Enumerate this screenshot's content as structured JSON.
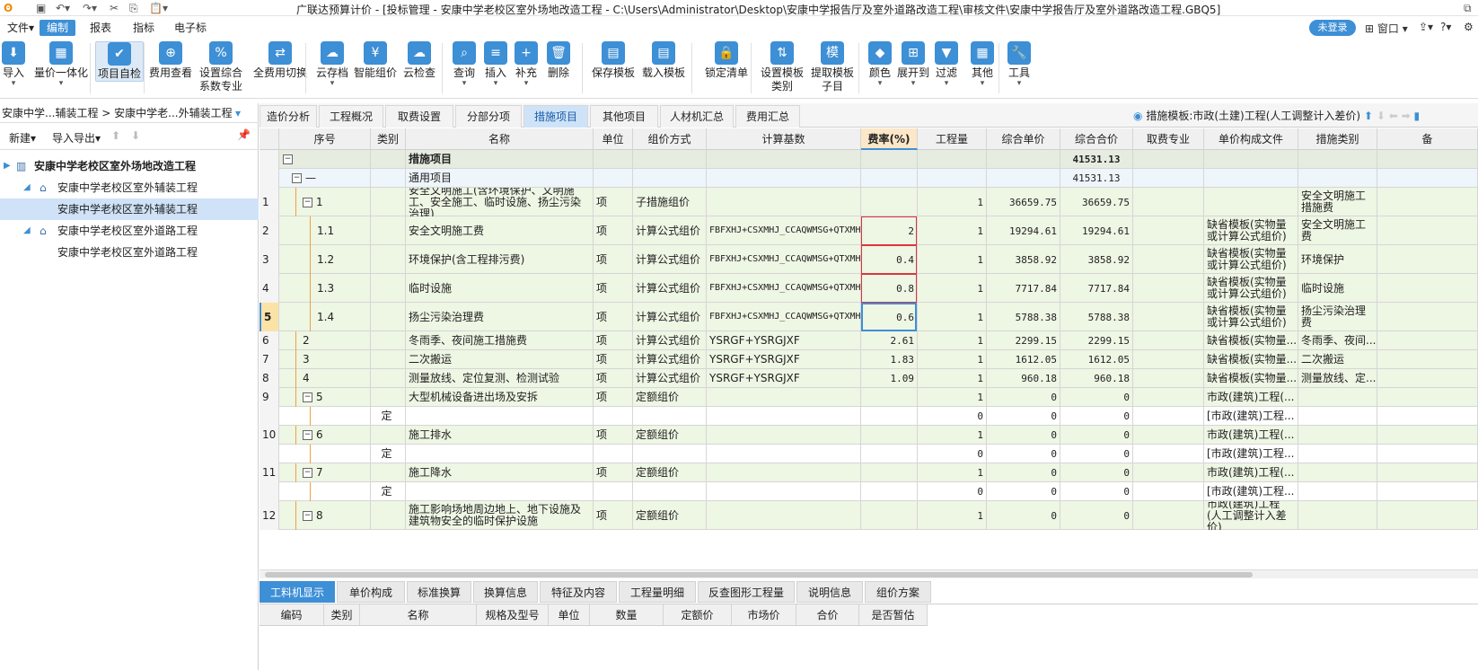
{
  "title": "广联达预算计价 - [投标管理 - 安康中学老校区室外场地改造工程 - C:\\Users\\Administrator\\Desktop\\安康中学报告厅及室外道路改造工程\\审核文件\\安康中学报告厅及室外道路改造工程.GBQ5]",
  "menu": [
    "文件▾",
    "编制",
    "报表",
    "指标",
    "电子标"
  ],
  "login": "未登录",
  "window_menu": "窗口 ▾",
  "ribbon": [
    {
      "label": "导入",
      "icon": "import-icon",
      "glyph": "⬇",
      "dd": true
    },
    {
      "label": "量价一体化",
      "icon": "integration-icon",
      "glyph": "▦",
      "dd": true
    },
    {
      "label": "项目自检",
      "icon": "self-check-icon",
      "glyph": "✔",
      "sel": true
    },
    {
      "label": "费用查看",
      "icon": "cost-view-icon",
      "glyph": "⊕"
    },
    {
      "label": "设置综合\n系数专业",
      "icon": "coefficient-icon",
      "glyph": "%"
    },
    {
      "label": "全费用切换",
      "icon": "full-cost-icon",
      "glyph": "⇄"
    },
    {
      "label": "云存档",
      "icon": "cloud-save-icon",
      "glyph": "☁",
      "dd": true
    },
    {
      "label": "智能组价",
      "icon": "smart-price-icon",
      "glyph": "¥"
    },
    {
      "label": "云检查",
      "icon": "cloud-check-icon",
      "glyph": "☁"
    },
    {
      "label": "查询",
      "icon": "query-icon",
      "glyph": "⌕",
      "dd": true
    },
    {
      "label": "插入",
      "icon": "insert-icon",
      "glyph": "≡",
      "dd": true
    },
    {
      "label": "补充",
      "icon": "supplement-icon",
      "glyph": "+",
      "dd": true
    },
    {
      "label": "删除",
      "icon": "delete-icon",
      "glyph": "🗑"
    },
    {
      "label": "保存模板",
      "icon": "save-template-icon",
      "glyph": "▤"
    },
    {
      "label": "载入模板",
      "icon": "load-template-icon",
      "glyph": "▤"
    },
    {
      "label": "锁定清单",
      "icon": "lock-icon",
      "glyph": "🔒"
    },
    {
      "label": "设置模板\n类别",
      "icon": "template-category-icon",
      "glyph": "⇅"
    },
    {
      "label": "提取模板\n子目",
      "icon": "extract-template-icon",
      "glyph": "模"
    },
    {
      "label": "颜色",
      "icon": "color-icon",
      "glyph": "◆",
      "dd": true
    },
    {
      "label": "展开到",
      "icon": "expand-icon",
      "glyph": "⊞",
      "dd": true
    },
    {
      "label": "过滤",
      "icon": "filter-icon",
      "glyph": "▼",
      "dd": true
    },
    {
      "label": "其他",
      "icon": "other-icon",
      "glyph": "▦",
      "dd": true
    },
    {
      "label": "工具",
      "icon": "tools-icon",
      "glyph": "🔧",
      "dd": true
    }
  ],
  "left": {
    "breadcrumb": "安康中学...辅装工程 > 安康中学老...外辅装工程",
    "new_btn": "新建▾",
    "import_export": "导入导出▾",
    "tree": [
      {
        "label": "安康中学老校区室外场地改造工程",
        "level": 0,
        "bold": true
      },
      {
        "label": "安康中学老校区室外辅装工程",
        "level": 1
      },
      {
        "label": "安康中学老校区室外辅装工程",
        "level": 2,
        "sel": true
      },
      {
        "label": "安康中学老校区室外道路工程",
        "level": 1
      },
      {
        "label": "安康中学老校区室外道路工程",
        "level": 2
      }
    ]
  },
  "tabs": [
    "造价分析",
    "工程概况",
    "取费设置",
    "分部分项",
    "措施项目",
    "其他项目",
    "人材机汇总",
    "费用汇总"
  ],
  "active_tab": 4,
  "template_label": "措施模板:市政(土建)工程(人工调整计入差价)",
  "columns": [
    "",
    "序号",
    "类别",
    "名称",
    "单位",
    "组价方式",
    "计算基数",
    "费率(%)",
    "工程量",
    "综合单价",
    "综合合价",
    "取费专业",
    "单价构成文件",
    "措施类别",
    "备"
  ],
  "rows": [
    {
      "n": "",
      "seq": "",
      "type": "",
      "name": "措施项目",
      "unit": "",
      "method": "",
      "base": "",
      "rate": "",
      "qty": "",
      "price": "",
      "total": "41531.13",
      "spec": "",
      "file": "",
      "cat": "",
      "kind": "header",
      "tog": "−",
      "lvl": 0
    },
    {
      "n": "",
      "seq": "—",
      "type": "",
      "name": "通用项目",
      "unit": "",
      "method": "",
      "base": "",
      "rate": "",
      "qty": "",
      "price": "",
      "total": "41531.13",
      "spec": "",
      "file": "",
      "cat": "",
      "kind": "group",
      "tog": "−",
      "lvl": 1
    },
    {
      "n": "1",
      "seq": "1",
      "type": "",
      "name": "安全文明施工(含环境保护、文明施工、安全施工、临时设施、扬尘污染治理)",
      "unit": "项",
      "method": "子措施组价",
      "base": "",
      "rate": "",
      "qty": "1",
      "price": "36659.75",
      "total": "36659.75",
      "spec": "",
      "file": "",
      "cat": "安全文明施工措施费",
      "tog": "−",
      "lvl": 2,
      "h": 32
    },
    {
      "n": "2",
      "seq": "1.1",
      "type": "",
      "name": "安全文明施工费",
      "unit": "项",
      "method": "计算公式组价",
      "base": "FBFXHJ+CSXMHJ_CCAQWMSG+QTXMHJ+FBFXRGCJ+CSXMRGCJ+QTXMRGCJ",
      "rate": "2",
      "qty": "1",
      "price": "19294.61",
      "total": "19294.61",
      "spec": "",
      "file": "缺省模板(实物量或计算公式组价)",
      "cat": "安全文明施工费",
      "lvl": 3,
      "h": 32
    },
    {
      "n": "3",
      "seq": "1.2",
      "type": "",
      "name": "环境保护(含工程排污费)",
      "unit": "项",
      "method": "计算公式组价",
      "base": "FBFXHJ+CSXMHJ_CCAQWMSG+QTXMHJ+FBFXRGCJ+CSXMRGCJ+QTXMRGCJ",
      "rate": "0.4",
      "qty": "1",
      "price": "3858.92",
      "total": "3858.92",
      "spec": "",
      "file": "缺省模板(实物量或计算公式组价)",
      "cat": "环境保护",
      "lvl": 3,
      "h": 32
    },
    {
      "n": "4",
      "seq": "1.3",
      "type": "",
      "name": "临时设施",
      "unit": "项",
      "method": "计算公式组价",
      "base": "FBFXHJ+CSXMHJ_CCAQWMSG+QTXMHJ+FBFXRGCJ+CSXMRGCJ+QTXMRGCJ",
      "rate": "0.8",
      "qty": "1",
      "price": "7717.84",
      "total": "7717.84",
      "spec": "",
      "file": "缺省模板(实物量或计算公式组价)",
      "cat": "临时设施",
      "lvl": 3,
      "h": 32
    },
    {
      "n": "5",
      "seq": "1.4",
      "type": "",
      "name": "扬尘污染治理费",
      "unit": "项",
      "method": "计算公式组价",
      "base": "FBFXHJ+CSXMHJ_CCAQWMSG+QTXMHJ+FBFXRGCJ+CSXMRGCJ+QTXMRGCJ",
      "rate": "0.6",
      "qty": "1",
      "price": "5788.38",
      "total": "5788.38",
      "spec": "",
      "file": "缺省模板(实物量或计算公式组价)",
      "cat": "扬尘污染治理费",
      "lvl": 3,
      "h": 32,
      "cur": true
    },
    {
      "n": "6",
      "seq": "2",
      "type": "",
      "name": "冬雨季、夜间施工措施费",
      "unit": "项",
      "method": "计算公式组价",
      "base": "YSRGF+YSRGJXF",
      "rate": "2.61",
      "qty": "1",
      "price": "2299.15",
      "total": "2299.15",
      "spec": "",
      "file": "缺省模板(实物量...",
      "cat": "冬雨季、夜间...",
      "lvl": 2
    },
    {
      "n": "7",
      "seq": "3",
      "type": "",
      "name": "二次搬运",
      "unit": "项",
      "method": "计算公式组价",
      "base": "YSRGF+YSRGJXF",
      "rate": "1.83",
      "qty": "1",
      "price": "1612.05",
      "total": "1612.05",
      "spec": "",
      "file": "缺省模板(实物量...",
      "cat": "二次搬运",
      "lvl": 2
    },
    {
      "n": "8",
      "seq": "4",
      "type": "",
      "name": "测量放线、定位复测、检测试验",
      "unit": "项",
      "method": "计算公式组价",
      "base": "YSRGF+YSRGJXF",
      "rate": "1.09",
      "qty": "1",
      "price": "960.18",
      "total": "960.18",
      "spec": "",
      "file": "缺省模板(实物量...",
      "cat": "测量放线、定...",
      "lvl": 2
    },
    {
      "n": "9",
      "seq": "5",
      "type": "",
      "name": "大型机械设备进出场及安拆",
      "unit": "项",
      "method": "定额组价",
      "base": "",
      "rate": "",
      "qty": "1",
      "price": "0",
      "total": "0",
      "spec": "",
      "file": "市政(建筑)工程(...",
      "cat": "",
      "tog": "−",
      "lvl": 2
    },
    {
      "n": "",
      "seq": "",
      "type": "定",
      "name": "",
      "unit": "",
      "method": "",
      "base": "",
      "rate": "",
      "qty": "0",
      "price": "0",
      "total": "0",
      "spec": "",
      "file": "[市政(建筑)工程...",
      "cat": "",
      "lvl": 3,
      "white": true
    },
    {
      "n": "10",
      "seq": "6",
      "type": "",
      "name": "施工排水",
      "unit": "项",
      "method": "定额组价",
      "base": "",
      "rate": "",
      "qty": "1",
      "price": "0",
      "total": "0",
      "spec": "",
      "file": "市政(建筑)工程(...",
      "cat": "",
      "tog": "−",
      "lvl": 2
    },
    {
      "n": "",
      "seq": "",
      "type": "定",
      "name": "",
      "unit": "",
      "method": "",
      "base": "",
      "rate": "",
      "qty": "0",
      "price": "0",
      "total": "0",
      "spec": "",
      "file": "[市政(建筑)工程...",
      "cat": "",
      "lvl": 3,
      "white": true
    },
    {
      "n": "11",
      "seq": "7",
      "type": "",
      "name": "施工降水",
      "unit": "项",
      "method": "定额组价",
      "base": "",
      "rate": "",
      "qty": "1",
      "price": "0",
      "total": "0",
      "spec": "",
      "file": "市政(建筑)工程(...",
      "cat": "",
      "tog": "−",
      "lvl": 2
    },
    {
      "n": "",
      "seq": "",
      "type": "定",
      "name": "",
      "unit": "",
      "method": "",
      "base": "",
      "rate": "",
      "qty": "0",
      "price": "0",
      "total": "0",
      "spec": "",
      "file": "[市政(建筑)工程...",
      "cat": "",
      "lvl": 3,
      "white": true
    },
    {
      "n": "12",
      "seq": "8",
      "type": "",
      "name": "施工影响场地周边地上、地下设施及建筑物安全的临时保护设施",
      "unit": "项",
      "method": "定额组价",
      "base": "",
      "rate": "",
      "qty": "1",
      "price": "0",
      "total": "0",
      "spec": "",
      "file": "市政(建筑)工程(人工调整计入差价)",
      "cat": "",
      "tog": "−",
      "lvl": 2,
      "h": 32
    }
  ],
  "bottom_tabs": [
    "工料机显示",
    "单价构成",
    "标准换算",
    "换算信息",
    "特征及内容",
    "工程量明细",
    "反查图形工程量",
    "说明信息",
    "组价方案"
  ],
  "bottom_columns": [
    "编码",
    "类别",
    "名称",
    "规格及型号",
    "单位",
    "数量",
    "定额价",
    "市场价",
    "合价",
    "是否暂估"
  ],
  "colors": {
    "accent": "#3d8fd6",
    "row_green": "#eef6e4",
    "header_row": "#e6ece0",
    "group_row": "#eef5fb",
    "highlight_border": "#d9363e"
  }
}
